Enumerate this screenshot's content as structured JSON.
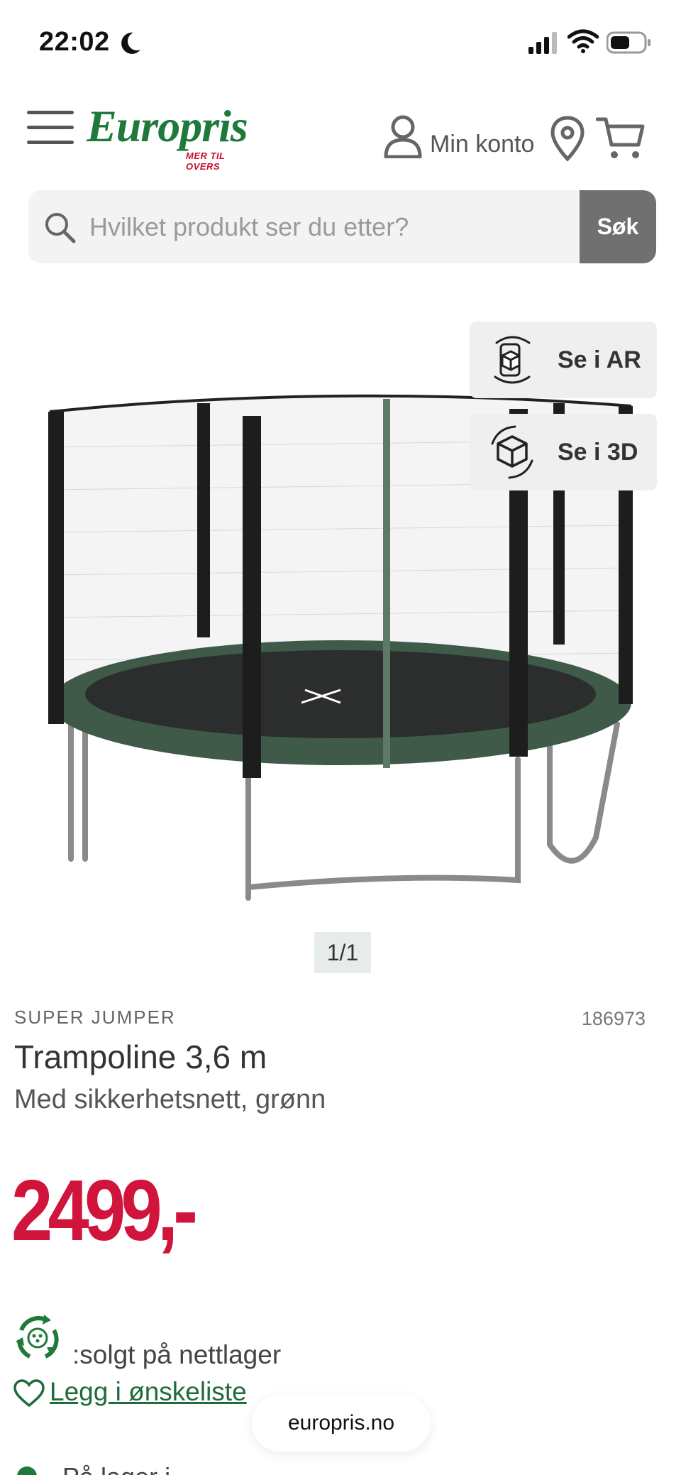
{
  "status": {
    "time": "22:02"
  },
  "header": {
    "logo_text": "Europris",
    "logo_tagline": "MER TIL OVERS",
    "account_label": "Min konto"
  },
  "search": {
    "placeholder": "Hvilket produkt ser du etter?",
    "button_label": "Søk"
  },
  "gallery": {
    "ar_label": "Se i AR",
    "view3d_label": "Se i 3D",
    "counter": "1/1"
  },
  "product": {
    "brand": "SUPER JUMPER",
    "sku": "186973",
    "title": "Trampoline 3,6 m",
    "subtitle": "Med sikkerhetsnett, grønn",
    "price": "2499,-",
    "stock_text": ":solgt på nettlager",
    "wishlist_label": "Legg i ønskeliste",
    "next_line_partial": "På lager i"
  },
  "browser": {
    "url": "europris.no"
  },
  "colors": {
    "brand_green": "#1f7a3a",
    "price_red": "#d0143c",
    "logo_red": "#c8102e"
  }
}
